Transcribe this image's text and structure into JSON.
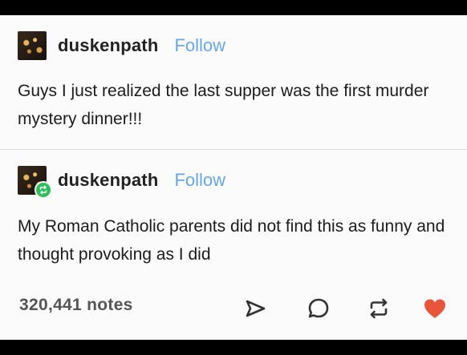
{
  "posts": [
    {
      "username": "duskenpath",
      "follow_label": "Follow",
      "text": "Guys I just realized the last supper was the first murder mystery dinner!!!"
    },
    {
      "username": "duskenpath",
      "follow_label": "Follow",
      "text": "My Roman Catholic parents did not find this as funny and thought provoking as I did"
    }
  ],
  "footer": {
    "notes": "320,441 notes",
    "icons": [
      "share-icon",
      "reply-icon",
      "reblog-icon",
      "heart-icon"
    ]
  },
  "colors": {
    "follow": "#68a7e3",
    "reblog_badge": "#2dbf58",
    "like": "#e8553b"
  }
}
